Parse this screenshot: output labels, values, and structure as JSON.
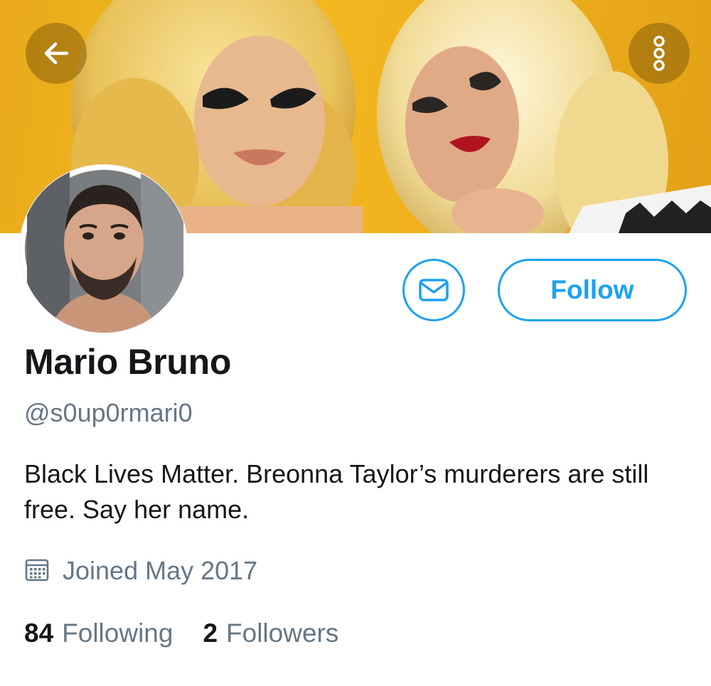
{
  "header": {
    "back_icon": "arrow-left-icon",
    "more_icon": "more-vertical-icon",
    "overlay_color": "#8a6208"
  },
  "profile": {
    "name": "Mario Bruno",
    "handle": "@s0up0rmari0",
    "bio": "Black Lives Matter. Breonna Taylor’s murderers are still free. Say her name.",
    "joined": "Joined May 2017",
    "joined_icon": "calendar-icon"
  },
  "actions": {
    "message_icon": "envelope-icon",
    "follow_label": "Follow",
    "accent_color": "#1da1f2"
  },
  "stats": {
    "following_count": "84",
    "following_label": "Following",
    "followers_count": "2",
    "followers_label": "Followers"
  }
}
